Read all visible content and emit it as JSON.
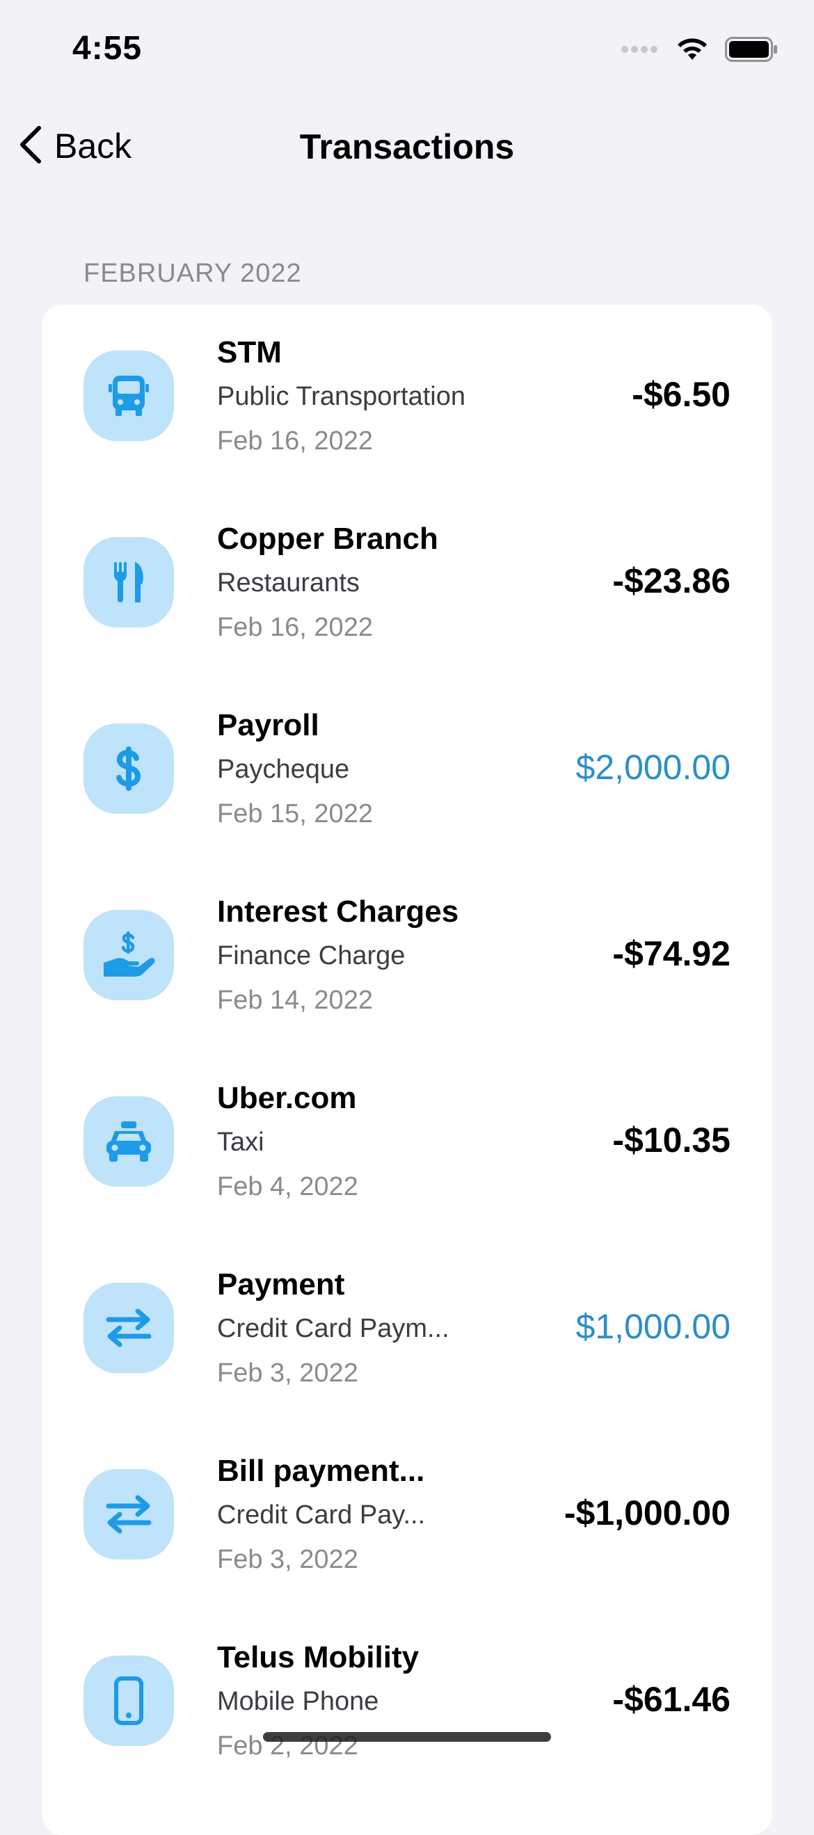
{
  "status_bar": {
    "time": "4:55"
  },
  "nav": {
    "back_label": "Back",
    "title": "Transactions"
  },
  "section": {
    "header": "FEBRUARY 2022"
  },
  "colors": {
    "background": "#F2F2F7",
    "icon_badge": "#BEE3FA",
    "icon": "#1E9BE6",
    "credit_amount": "#2A8FC6",
    "secondary_text": "#8A8A8E"
  },
  "transactions": [
    {
      "merchant": "STM",
      "category": "Public Transportation",
      "date": "Feb 16, 2022",
      "amount": "-$6.50",
      "icon": "bus-icon",
      "credit": false
    },
    {
      "merchant": "Copper Branch",
      "category": "Restaurants",
      "date": "Feb 16, 2022",
      "amount": "-$23.86",
      "icon": "fork-knife-icon",
      "credit": false
    },
    {
      "merchant": "Payroll",
      "category": "Paycheque",
      "date": "Feb 15, 2022",
      "amount": "$2,000.00",
      "icon": "dollar-sign-icon",
      "credit": true
    },
    {
      "merchant": "Interest Charges",
      "category": "Finance Charge",
      "date": "Feb 14, 2022",
      "amount": "-$74.92",
      "icon": "hand-dollar-icon",
      "credit": false
    },
    {
      "merchant": "Uber.com",
      "category": "Taxi",
      "date": "Feb 4, 2022",
      "amount": "-$10.35",
      "icon": "taxi-icon",
      "credit": false
    },
    {
      "merchant": "Payment",
      "category": "Credit Card Paym...",
      "date": "Feb 3, 2022",
      "amount": "$1,000.00",
      "icon": "transfer-arrows-icon",
      "credit": true
    },
    {
      "merchant": "Bill payment...",
      "category": "Credit Card Pay...",
      "date": "Feb 3, 2022",
      "amount": "-$1,000.00",
      "icon": "transfer-arrows-icon",
      "credit": false
    },
    {
      "merchant": "Telus Mobility",
      "category": "Mobile Phone",
      "date": "Feb 2, 2022",
      "amount": "-$61.46",
      "icon": "mobile-phone-icon",
      "credit": false
    }
  ]
}
